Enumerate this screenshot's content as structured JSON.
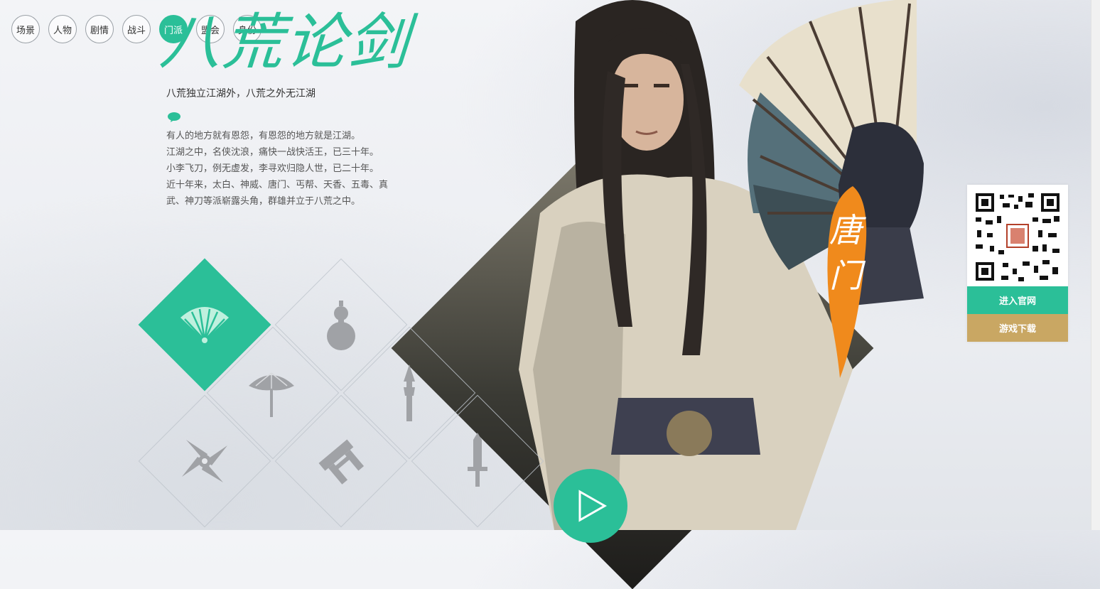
{
  "nav": {
    "items": [
      {
        "label": "场景",
        "active": false
      },
      {
        "label": "人物",
        "active": false
      },
      {
        "label": "剧情",
        "active": false
      },
      {
        "label": "战斗",
        "active": false
      },
      {
        "label": "门派",
        "active": true
      },
      {
        "label": "盟会",
        "active": false
      },
      {
        "label": "身份",
        "active": false
      }
    ]
  },
  "hero": {
    "title": "八荒论剑",
    "subtitle": "八荒独立江湖外，八荒之外无江湖",
    "description": [
      "有人的地方就有恩怨，有恩怨的地方就是江湖。",
      "江湖之中，名侠沈浪，痛快一战快活王，已三十年。",
      "小李飞刀，例无虚发，李寻欢归隐人世，已二十年。",
      "近十年来，太白、神威、唐门、丐帮、天香、五毒、真",
      "武、神刀等派崭露头角，群雄并立于八荒之中。"
    ]
  },
  "sects": {
    "selected": "唐门",
    "icons": [
      "fan-icon",
      "gourd-icon",
      "umbrella-icon",
      "brush-spear-icon",
      "shuriken-icon",
      "hammer-icon",
      "sword-icon"
    ]
  },
  "character": {
    "sect_name": "唐门"
  },
  "side_panel": {
    "official_label": "进入官网",
    "download_label": "游戏下载"
  },
  "colors": {
    "accent": "#2bbf98",
    "gold": "#c9a763",
    "orange": "#f08a1c",
    "icon_gray": "#a0a2a6"
  }
}
